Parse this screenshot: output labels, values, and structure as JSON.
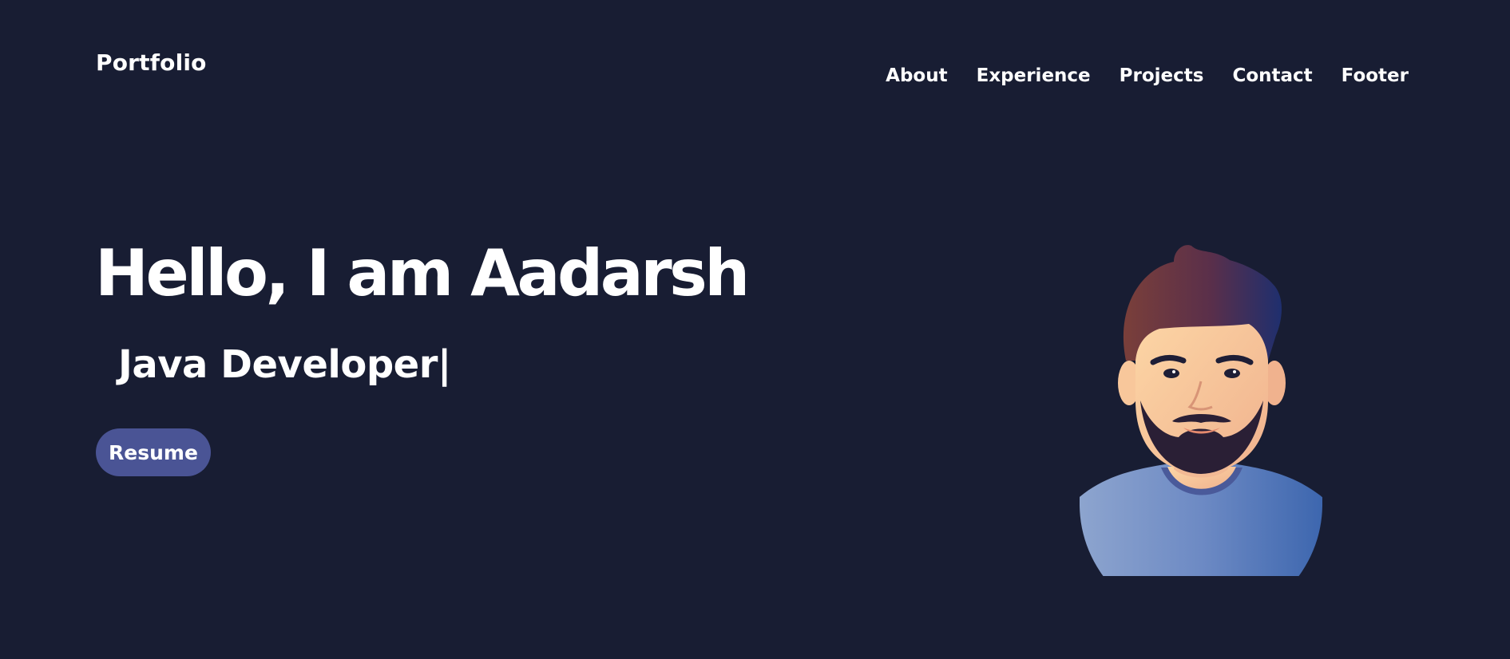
{
  "header": {
    "brand": "Portfolio",
    "nav": [
      {
        "label": "About"
      },
      {
        "label": "Experience"
      },
      {
        "label": "Projects"
      },
      {
        "label": "Contact"
      },
      {
        "label": "Footer"
      }
    ]
  },
  "hero": {
    "title": "Hello, I am Aadarsh",
    "role": "Java Developer|",
    "resume_label": "Resume"
  },
  "colors": {
    "background": "#181d33",
    "button": "#4a5495",
    "text": "#ffffff"
  },
  "icons": {
    "avatar": "avatar-illustration"
  }
}
